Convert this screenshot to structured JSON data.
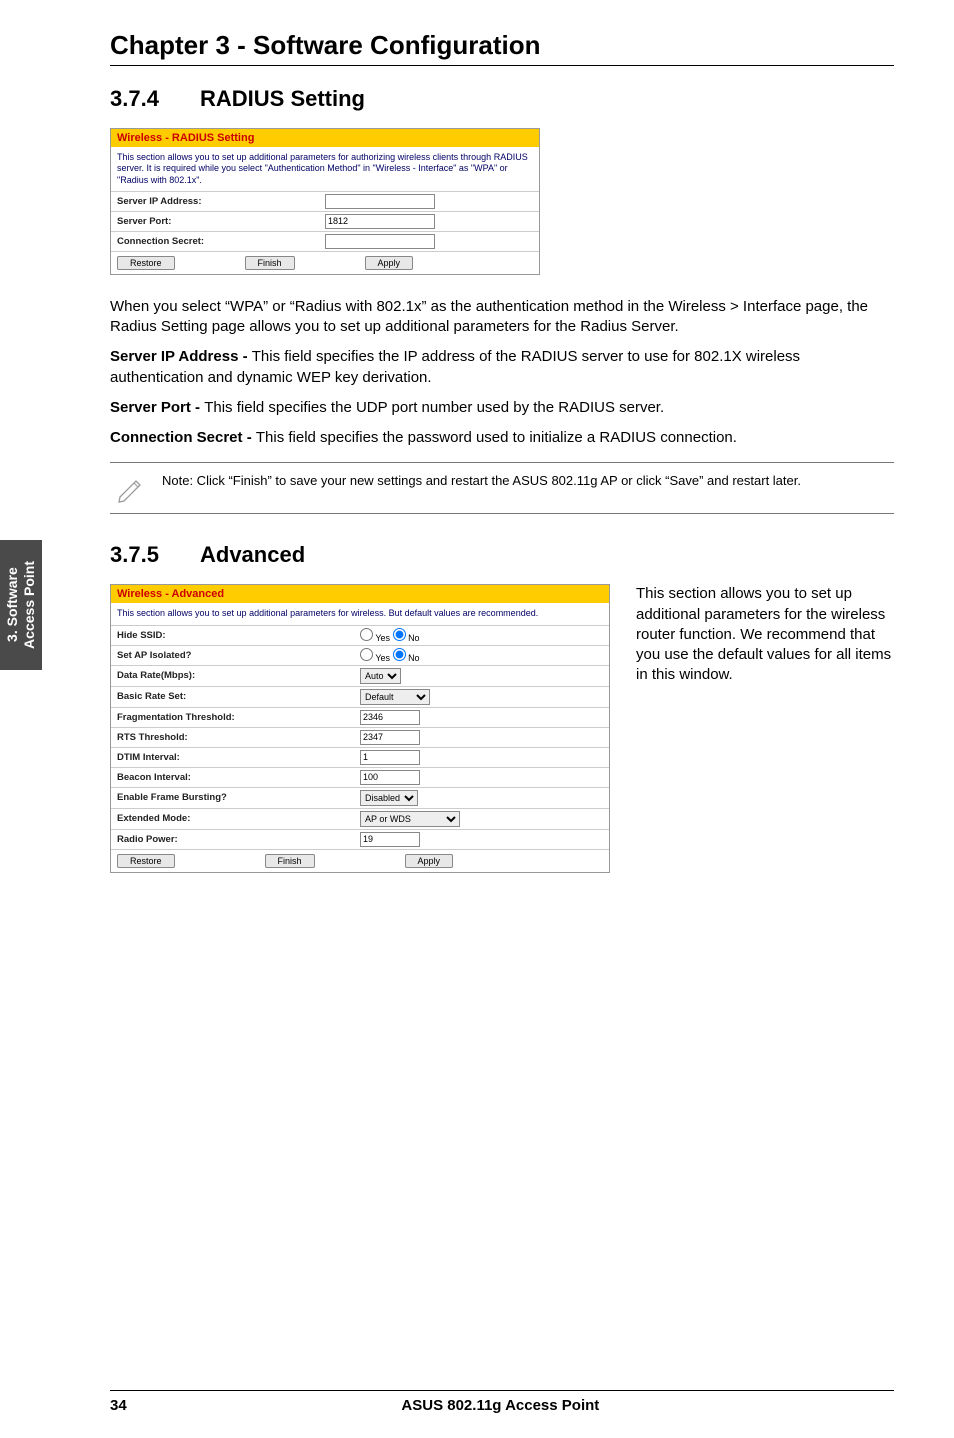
{
  "chapter_title": "Chapter 3 - Software Configuration",
  "sidebar": {
    "line1": "3. Software",
    "line2": "Access Point"
  },
  "sec374": {
    "num": "3.7.4",
    "title": "RADIUS Setting",
    "shot": {
      "header": "Wireless - RADIUS Setting",
      "desc": "This section allows you to set up additional parameters for authorizing wireless clients through RADIUS server. It is required while you select \"Authentication Method\" in \"Wireless - Interface\" as \"WPA\" or \"Radius with 802.1x\".",
      "rows": {
        "ip_label": "Server IP Address:",
        "ip_value": "",
        "port_label": "Server Port:",
        "port_value": "1812",
        "secret_label": "Connection Secret:",
        "secret_value": ""
      },
      "buttons": {
        "restore": "Restore",
        "finish": "Finish",
        "apply": "Apply"
      }
    },
    "paras": {
      "p1": "When you select “WPA” or “Radius with 802.1x” as the authentication method in the Wireless > Interface page, the Radius Setting page allows you to set up additional parameters for the Radius Server.",
      "p2a": "Server IP Address - ",
      "p2b": "This field specifies the IP address of the RADIUS server to use for 802.1X wireless authentication and dynamic WEP key derivation.",
      "p3a": "Server Port - ",
      "p3b": "This field specifies the UDP port number used by the RADIUS server.",
      "p4a": "Connection Secret - ",
      "p4b": "This field specifies the password used to initialize a RADIUS connection."
    },
    "note": "Note: Click “Finish” to save your new settings and restart the ASUS 802.11g AP or click “Save” and restart later."
  },
  "sec375": {
    "num": "3.7.5",
    "title": "Advanced",
    "shot": {
      "header": "Wireless - Advanced",
      "desc": "This section allows you to set up additional parameters for wireless. But default values are recommended.",
      "rows": {
        "hide_ssid": "Hide SSID:",
        "ap_isolated": "Set AP Isolated?",
        "data_rate": "Data Rate(Mbps):",
        "data_rate_val": "Auto",
        "basic_rate": "Basic Rate Set:",
        "basic_rate_val": "Default",
        "frag": "Fragmentation Threshold:",
        "frag_val": "2346",
        "rts": "RTS Threshold:",
        "rts_val": "2347",
        "dtim": "DTIM Interval:",
        "dtim_val": "1",
        "beacon": "Beacon Interval:",
        "beacon_val": "100",
        "burst": "Enable Frame Bursting?",
        "burst_val": "Disabled",
        "ext_mode": "Extended Mode:",
        "ext_mode_val": "AP or WDS",
        "radio": "Radio Power:",
        "radio_val": "19",
        "radio_yes": "Yes",
        "radio_no": "No"
      },
      "buttons": {
        "restore": "Restore",
        "finish": "Finish",
        "apply": "Apply"
      }
    },
    "side": "This section allows you to set up additional parameters for the wireless router function. We recommend that you use the default values for all items in this window."
  },
  "footer": {
    "page": "34",
    "product": "ASUS 802.11g Access Point"
  }
}
